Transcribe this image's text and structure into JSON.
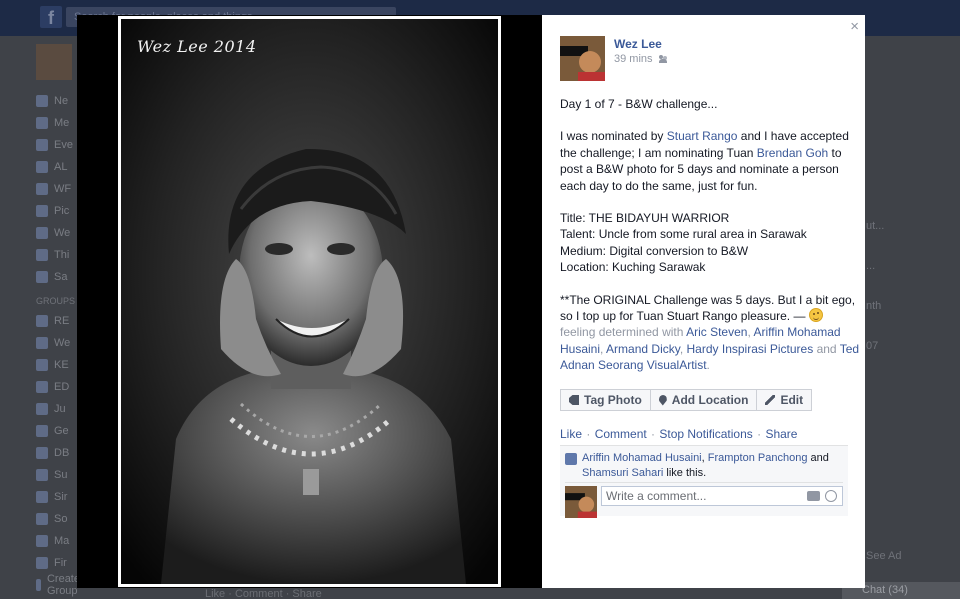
{
  "background": {
    "search_placeholder": "Search for people, places and things",
    "sidebar_items": [
      "Ne",
      "Me",
      "Eve",
      "AL",
      "WF",
      "Pic",
      "We",
      "Thi",
      "Sa"
    ],
    "groups_head": "GROUPS",
    "group_items": [
      "RE",
      "We",
      "KE",
      "ED",
      "Ju",
      "Ge",
      "DB",
      "Su",
      "Sir",
      "So",
      "Ma",
      "Fir",
      "Create Group"
    ],
    "right_items": [
      "ut...",
      "...",
      "nth",
      "07"
    ],
    "chat_label": "Chat (34)",
    "bottom_text": "Like · Comment · Share",
    "see_ad": "See Ad"
  },
  "viewer": {
    "watermark": "Wez Lee 2014",
    "close_label": "×",
    "author": {
      "name": "Wez Lee",
      "time": "39 mins"
    },
    "post": {
      "line1": "Day 1 of 7 - B&W challenge...",
      "nominated_prefix": "I was nominated by ",
      "nominator": "Stuart Rango",
      "nominated_mid": " and I have accepted the challenge; I am nominating Tuan ",
      "nominee": "Brendan Goh",
      "nominated_suffix": " to post a B&W photo for 5 days and nominate a person each day to do the same, just for fun.",
      "title_line": "Title: THE BIDAYUH WARRIOR",
      "talent_line": "Talent: Uncle from some rural area in Sarawak",
      "medium_line": "Medium: Digital conversion to B&W",
      "location_line": "Location: Kuching Sarawak",
      "original_text": "**The ORIGINAL Challenge was 5 days. But I a bit ego, so I top up for Tuan Stuart Rango pleasure. — ",
      "feeling": "feeling determined with ",
      "tag1": "Aric Steven",
      "tag2": "Ariffin Mohamad Husaini",
      "tag3": "Armand Dicky",
      "tag4": "Hardy Inspirasi Pictures",
      "and_word": " and ",
      "tag5": "Ted Adnan Seorang VisualArtist",
      "period": ".",
      "comma": ", "
    },
    "actions": {
      "tag_photo": "Tag Photo",
      "add_location": "Add Location",
      "edit": "Edit"
    },
    "ufi": {
      "like": "Like",
      "comment": "Comment",
      "stop_notifications": "Stop Notifications",
      "share": "Share",
      "dot": " · "
    },
    "likes": {
      "liker1": "Ariffin Mohamad Husaini",
      "liker2": "Frampton Panchong",
      "and_word": " and ",
      "liker3": "Shamsuri Sahari",
      "suffix": " like this.",
      "comma": ", "
    },
    "comment_placeholder": "Write a comment..."
  }
}
